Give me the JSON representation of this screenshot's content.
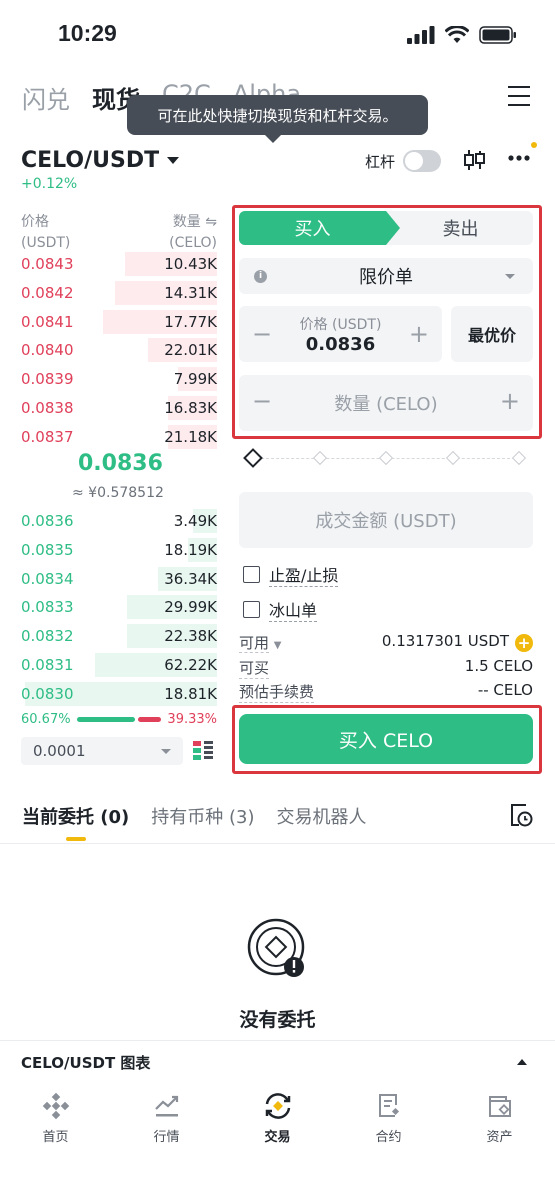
{
  "status_bar": {
    "time": "10:29"
  },
  "top_tabs": [
    "闪兑",
    "现货",
    "C2C",
    "Alpha"
  ],
  "tooltip": "可在此处快捷切换现货和杠杆交易。",
  "pair": {
    "name": "CELO/USDT",
    "change": "+0.12%",
    "margin_label": "杠杆"
  },
  "order_book": {
    "price_header": "价格",
    "price_unit": "(USDT)",
    "qty_header": "数量 ⇋",
    "qty_unit": "(CELO)",
    "asks": [
      {
        "price": "0.0843",
        "qty": "10.43K",
        "depth": 0.47
      },
      {
        "price": "0.0842",
        "qty": "14.31K",
        "depth": 0.52
      },
      {
        "price": "0.0841",
        "qty": "17.77K",
        "depth": 0.58
      },
      {
        "price": "0.0840",
        "qty": "22.01K",
        "depth": 0.35
      },
      {
        "price": "0.0839",
        "qty": "7.99K",
        "depth": 0.2
      },
      {
        "price": "0.0838",
        "qty": "16.83K",
        "depth": 0.25
      },
      {
        "price": "0.0837",
        "qty": "21.18K",
        "depth": 0.25
      }
    ],
    "mid_price": "0.0836",
    "mid_fiat": "≈ ¥0.578512",
    "bids": [
      {
        "price": "0.0836",
        "qty": "3.49K",
        "depth": 0.12
      },
      {
        "price": "0.0835",
        "qty": "18.19K",
        "depth": 0.15
      },
      {
        "price": "0.0834",
        "qty": "36.34K",
        "depth": 0.3
      },
      {
        "price": "0.0833",
        "qty": "29.99K",
        "depth": 0.46
      },
      {
        "price": "0.0832",
        "qty": "22.38K",
        "depth": 0.46
      },
      {
        "price": "0.0831",
        "qty": "62.22K",
        "depth": 0.62
      },
      {
        "price": "0.0830",
        "qty": "18.81K",
        "depth": 0.98
      }
    ],
    "buy_ratio": "60.67%",
    "sell_ratio": "39.33%",
    "precision": "0.0001"
  },
  "form": {
    "buy_tab": "买入",
    "sell_tab": "卖出",
    "order_type": "限价单",
    "price_label": "价格 (USDT)",
    "price_value": "0.0836",
    "best_price": "最优价",
    "qty_placeholder": "数量 (CELO)",
    "amount_placeholder": "成交金额 (USDT)",
    "tp_sl": "止盈/止损",
    "iceberg": "冰山单",
    "available_label": "可用",
    "available_value": "0.1317301 USDT",
    "can_buy_label": "可买",
    "can_buy_value": "1.5 CELO",
    "fee_label": "预估手续费",
    "fee_value": "-- CELO",
    "buy_button": "买入 CELO"
  },
  "lower_tabs": {
    "open_orders": "当前委托 (0)",
    "holdings": "持有币种 (3)",
    "bots": "交易机器人"
  },
  "empty": "没有委托",
  "chart_bar": "CELO/USDT 图表",
  "nav": [
    {
      "label": "首页",
      "icon": "home-icon"
    },
    {
      "label": "行情",
      "icon": "markets-icon"
    },
    {
      "label": "交易",
      "icon": "trade-icon"
    },
    {
      "label": "合约",
      "icon": "futures-icon"
    },
    {
      "label": "资产",
      "icon": "wallet-icon"
    }
  ],
  "colors": {
    "green": "#2ebd85",
    "red": "#e0405a",
    "accent": "#f0b90b",
    "highlight_box": "#d9363e"
  }
}
